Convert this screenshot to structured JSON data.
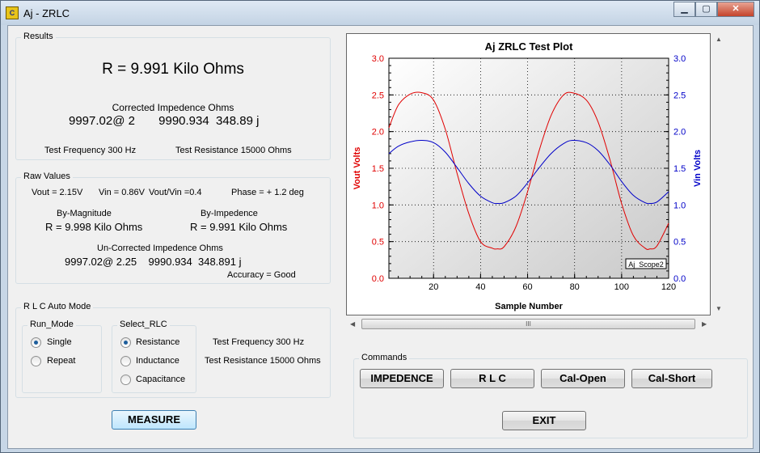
{
  "window": {
    "title": "Aj - ZRLC",
    "icon_text": "C",
    "min_label": "▁",
    "max_label": "▢",
    "close_label": "✕"
  },
  "results": {
    "group_label": "Results",
    "main": "R = 9.991  Kilo Ohms",
    "corrected_label": "Corrected Impedence Ohms",
    "corrected_values": "9997.02@ 2       9990.934  348.89 j",
    "test_frequency": "Test Frequency  300  Hz",
    "test_resistance": "Test Resistance  15000 Ohms"
  },
  "raw": {
    "group_label": "Raw Values",
    "vout": "Vout = 2.15V",
    "vin": "Vin = 0.86V",
    "ratio": "Vout/Vin =0.4",
    "phase": "Phase = + 1.2 deg",
    "by_magnitude_label": "By-Magnitude",
    "by_magnitude_value": "R = 9.998  Kilo Ohms",
    "by_impedence_label": "By-Impedence",
    "by_impedence_value": "R = 9.991  Kilo Ohms",
    "uncorrected_label": "Un-Corrected Impedence Ohms",
    "uncorrected_values": "9997.02@ 2.25    9990.934  348.891 j",
    "accuracy": "Accuracy = Good"
  },
  "auto": {
    "group_label": "R L C Auto Mode",
    "run_mode_label": "Run_Mode",
    "run_single": "Single",
    "run_repeat": "Repeat",
    "select_label": "Select_RLC",
    "sel_resistance": "Resistance",
    "sel_inductance": "Inductance",
    "sel_capacitance": "Capacitance",
    "test_frequency": "Test Frequency  300  Hz",
    "test_resistance": "Test Resistance  15000 Ohms",
    "run_mode_selected": "Single",
    "rlc_selected": "Resistance"
  },
  "measure_label": "MEASURE",
  "commands": {
    "group_label": "Commands",
    "impedence": "IMPEDENCE",
    "rlc": "R  L  C",
    "cal_open": "Cal-Open",
    "cal_short": "Cal-Short",
    "exit": "EXIT"
  },
  "scrollbar": {
    "thumb_grip": "III",
    "left_arrow": "◀",
    "right_arrow": "▶",
    "up_arrow": "▲",
    "down_arrow": "▼"
  },
  "chart_data": {
    "type": "line",
    "title": "Aj ZRLC Test Plot",
    "xlabel": "Sample Number",
    "ylabel": "Vout Volts",
    "y2label": "Vin Volts",
    "xlim": [
      1,
      120
    ],
    "ylim": [
      0,
      3.0
    ],
    "y2lim": [
      0,
      3.0
    ],
    "xticks": [
      20,
      40,
      60,
      80,
      100,
      120
    ],
    "yticks": [
      0.0,
      0.5,
      1.0,
      1.5,
      2.0,
      2.5,
      3.0
    ],
    "ytick_labels": [
      "0.0",
      "0.5",
      "1.0",
      "1.5",
      "2.0",
      "2.5",
      "3.0"
    ],
    "y2ticks": [
      0.0,
      0.5,
      1.0,
      1.5,
      2.0,
      2.5,
      3.0
    ],
    "y2tick_labels": [
      "0.0",
      "0.5",
      "1.0",
      "1.5",
      "2.0",
      "2.5",
      "3.0"
    ],
    "grid": true,
    "legend_box": "Aj_Scope2",
    "colors": {
      "vout": "#e00000",
      "vin": "#0000c8"
    },
    "series": [
      {
        "name": "Vout Volts",
        "axis": "left",
        "color": "#e00000",
        "x": [
          1,
          5,
          10,
          15,
          20,
          25,
          30,
          35,
          40,
          45,
          47,
          50,
          55,
          60,
          65,
          70,
          75,
          79,
          85,
          90,
          95,
          100,
          105,
          110,
          112,
          115,
          120
        ],
        "y": [
          2.05,
          2.36,
          2.51,
          2.53,
          2.43,
          2.03,
          1.43,
          0.88,
          0.5,
          0.41,
          0.4,
          0.43,
          0.7,
          1.18,
          1.75,
          2.22,
          2.49,
          2.53,
          2.43,
          2.13,
          1.62,
          1.02,
          0.58,
          0.41,
          0.4,
          0.44,
          0.75
        ]
      },
      {
        "name": "Vin Volts",
        "axis": "right",
        "color": "#0000c8",
        "x": [
          1,
          5,
          10,
          15,
          20,
          25,
          30,
          35,
          40,
          45,
          47,
          50,
          55,
          60,
          65,
          70,
          75,
          79,
          85,
          90,
          95,
          100,
          105,
          110,
          112,
          115,
          120
        ],
        "y": [
          1.7,
          1.8,
          1.86,
          1.88,
          1.85,
          1.72,
          1.51,
          1.29,
          1.12,
          1.03,
          1.02,
          1.03,
          1.12,
          1.3,
          1.51,
          1.7,
          1.83,
          1.88,
          1.85,
          1.74,
          1.55,
          1.32,
          1.13,
          1.03,
          1.02,
          1.04,
          1.18
        ]
      }
    ]
  }
}
